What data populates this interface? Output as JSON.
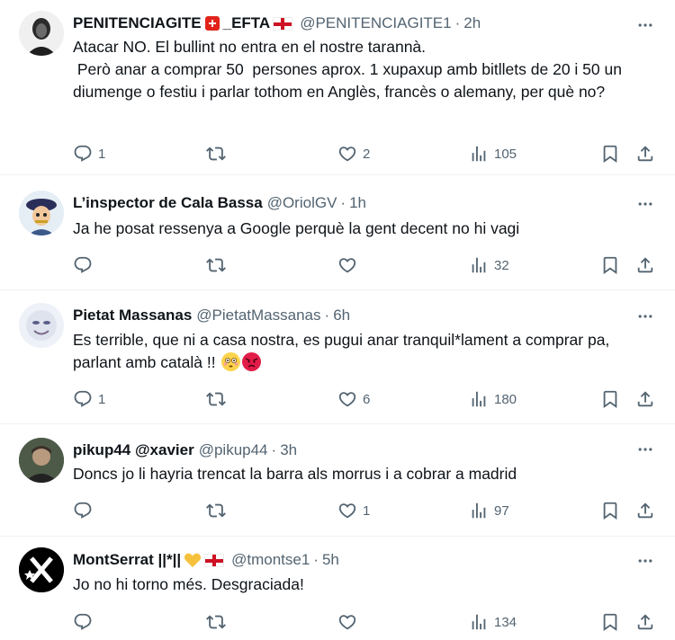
{
  "tweets": [
    {
      "name": "PENITENCIAGITE",
      "name_suffix": "_EFTA",
      "handle": "@PENITENCIAGITE1",
      "dot": "·",
      "time": "2h",
      "text": "Atacar NO. El bullint no entra en el nostre tarannà.\n Però anar a comprar 50  persones aprox. 1 xupaxup amb bitllets de 20 i 50 un diumenge o festiu i parlar tothom en Anglès, francès o alemany, per què no?",
      "replies": "1",
      "retweets": "",
      "likes": "2",
      "views": "105"
    },
    {
      "name": "L’inspector de Cala Bassa",
      "handle": "@OriolGV",
      "dot": "·",
      "time": "1h",
      "text": "Ja he posat ressenya a Google perquè la gent decent no hi vagi",
      "replies": "",
      "retweets": "",
      "likes": "",
      "views": "32"
    },
    {
      "name": "Pietat Massanas",
      "handle": "@PietatMassanas",
      "dot": "·",
      "time": "6h",
      "text": "Es terrible, que ni a casa nostra, es pugui anar tranquil*lament a comprar pa, parlant amb català !! ",
      "replies": "1",
      "retweets": "",
      "likes": "6",
      "views": "180"
    },
    {
      "name": "pikup44 @xavier",
      "handle": "@pikup44",
      "dot": "·",
      "time": "3h",
      "text": "Doncs jo li hayria trencat la barra als morrus i a cobrar a madrid",
      "replies": "",
      "retweets": "",
      "likes": "1",
      "views": "97"
    },
    {
      "name": "MontSerrat ||*||",
      "handle": "@tmontse1",
      "dot": "·",
      "time": "5h",
      "text": "Jo no hi torno més. Desgraciada!",
      "replies": "",
      "retweets": "",
      "likes": "",
      "views": "134"
    }
  ],
  "icons": {
    "reply": "reply-icon",
    "retweet": "retweet-icon",
    "like": "heart-icon",
    "views": "views-chart-icon",
    "bookmark": "bookmark-icon",
    "share": "share-icon",
    "more": "more-icon"
  },
  "colors": {
    "text": "#0f1419",
    "secondary": "#536471",
    "divider": "#eff3f4",
    "flag_red": "#ce1124"
  }
}
